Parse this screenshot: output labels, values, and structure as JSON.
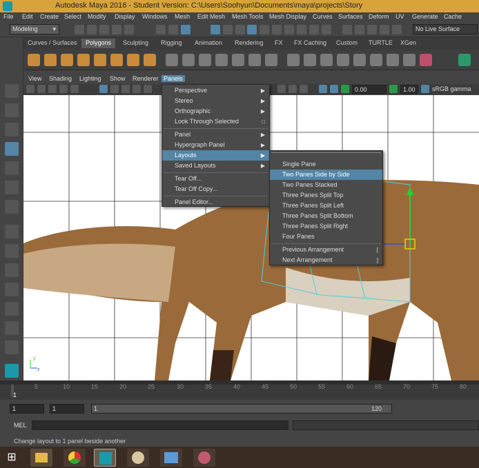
{
  "window": {
    "title": "Autodesk Maya 2016 - Student Version: C:\\Users\\Soohyun\\Documents\\maya\\projects\\Story"
  },
  "menubar": [
    "File",
    "Edit",
    "Create",
    "Select",
    "Modify",
    "Display",
    "Windows",
    "Mesh",
    "Edit Mesh",
    "Mesh Tools",
    "Mesh Display",
    "Curves",
    "Surfaces",
    "Deform",
    "UV",
    "Generate",
    "Cache"
  ],
  "statusline": {
    "mode": "Modeling",
    "live_surface": "No Live Surface"
  },
  "shelf_tabs": [
    {
      "label": "Curves / Surfaces",
      "active": false
    },
    {
      "label": "Polygons",
      "active": true
    },
    {
      "label": "Sculpting",
      "active": false
    },
    {
      "label": "Rigging",
      "active": false
    },
    {
      "label": "Animation",
      "active": false
    },
    {
      "label": "Rendering",
      "active": false
    },
    {
      "label": "FX",
      "active": false
    },
    {
      "label": "FX Caching",
      "active": false
    },
    {
      "label": "Custom",
      "active": false
    },
    {
      "label": "TURTLE",
      "active": false
    },
    {
      "label": "XGen",
      "active": false
    }
  ],
  "panel_menu": [
    "View",
    "Shading",
    "Lighting",
    "Show",
    "Renderer",
    "Panels"
  ],
  "panel_toolbar": {
    "gamma_value": "0.00",
    "exposure_value": "1.00",
    "color_space": "sRGB gamma"
  },
  "panels_menu": {
    "items": [
      {
        "label": "Perspective",
        "submenu": true
      },
      {
        "label": "Stereo",
        "submenu": true
      },
      {
        "label": "Orthographic",
        "submenu": true
      },
      {
        "label": "Look Through Selected",
        "option": true
      },
      {
        "label": "Panel",
        "submenu": true
      },
      {
        "label": "Hypergraph Panel",
        "submenu": true
      },
      {
        "label": "Layouts",
        "submenu": true,
        "highlighted": true
      },
      {
        "label": "Saved Layouts",
        "submenu": true
      },
      {
        "label": "Tear Off..."
      },
      {
        "label": "Tear Off Copy..."
      },
      {
        "label": "Panel Editor..."
      }
    ]
  },
  "layouts_menu": {
    "items": [
      {
        "label": "Single Pane"
      },
      {
        "label": "Two Panes Side by Side",
        "highlighted": true
      },
      {
        "label": "Two Panes Stacked"
      },
      {
        "label": "Three Panes Split Top"
      },
      {
        "label": "Three Panes Split Left"
      },
      {
        "label": "Three Panes Split Bottom"
      },
      {
        "label": "Three Panes Split Right"
      },
      {
        "label": "Four Panes"
      },
      {
        "label": "Previous Arrangement",
        "hotkey": "["
      },
      {
        "label": "Next Arrangement",
        "hotkey": "]"
      }
    ]
  },
  "timeline": {
    "ticks": [
      "5",
      "10",
      "15",
      "20",
      "25",
      "30",
      "35",
      "40",
      "45",
      "50",
      "55",
      "60",
      "65",
      "70",
      "75",
      "80"
    ],
    "current_frame": "1"
  },
  "range_slider": {
    "start_frame": "1",
    "anim_start": "1",
    "range_start": "1",
    "range_end": "120"
  },
  "command_line": {
    "label": "MEL"
  },
  "help_line": {
    "text": "Change layout to 1 panel beside another"
  },
  "taskbar": {
    "apps": [
      "start-icon",
      "file-explorer-icon",
      "chrome-icon",
      "maya-icon",
      "paint-icon",
      "photos-icon",
      "snipping-icon"
    ]
  },
  "colors": {
    "title_bar": "#d8a33a",
    "highlight": "#5285a6",
    "manipulator_green": "#2bd12b",
    "manipulator_yellow": "#e8d800",
    "wireframe_cyan": "#4ecfe0"
  }
}
